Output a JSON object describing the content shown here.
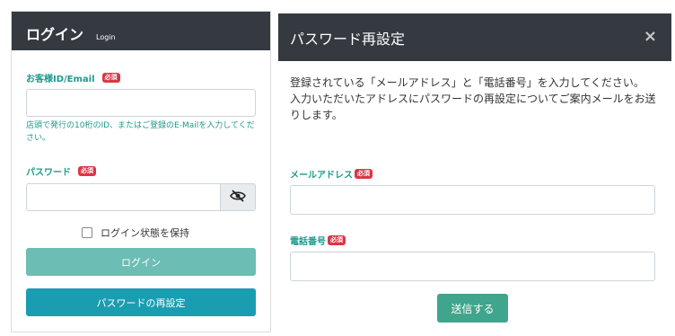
{
  "login": {
    "title": "ログイン",
    "subtitle": "Login",
    "id_label": "お客様ID/Email",
    "required_badge": "必須",
    "id_value": "",
    "id_hint": "店頭で発行の10桁のID、またはご登録のE-Mailを入力してください。",
    "password_label": "パスワード",
    "password_value": "",
    "toggle_icon": "eye-slash-icon",
    "remember_label": "ログイン状態を保持",
    "remember_checked": false,
    "login_button": "ログイン",
    "reset_button": "パスワードの再設定"
  },
  "reset_modal": {
    "title": "パスワード再設定",
    "close_glyph": "×",
    "description_line1": "登録されている「メールアドレス」と「電話番号」を入力してください。",
    "description_line2": "入力いただいたアドレスにパスワードの再設定についてご案内メールをお送りします。",
    "email_label": "メールアドレス",
    "phone_label": "電話番号",
    "required_badge": "必須",
    "email_value": "",
    "phone_value": "",
    "send_button": "送信する"
  },
  "colors": {
    "header_bg": "#343a40",
    "label_teal": "#1d9a8c",
    "required_red": "#dc3545",
    "login_button": "#6cbdb4",
    "reset_button": "#1a9db0",
    "send_button": "#3fa58c"
  }
}
